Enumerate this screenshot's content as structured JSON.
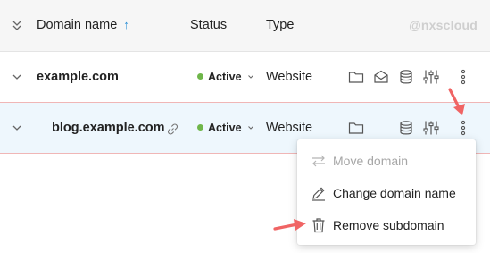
{
  "header": {
    "domain_name": "Domain name",
    "sort_arrow": "↑",
    "status": "Status",
    "type": "Type",
    "watermark": "@nxscloud"
  },
  "rows": [
    {
      "domain": "example.com",
      "status": "Active",
      "type": "Website",
      "icons": [
        "folder-icon",
        "mail-icon",
        "database-icon",
        "settings-sliders-icon",
        "more-options-icon"
      ]
    },
    {
      "domain": "blog.example.com",
      "status": "Active",
      "type": "Website",
      "icons": [
        "link-icon",
        "folder-icon",
        "database-icon",
        "settings-sliders-icon",
        "more-options-icon"
      ]
    }
  ],
  "context_menu": {
    "items": [
      {
        "label": "Move domain",
        "icon": "swap-arrows-icon",
        "enabled": false
      },
      {
        "label": "Change domain name",
        "icon": "pencil-icon",
        "enabled": true
      },
      {
        "label": "Remove subdomain",
        "icon": "trash-icon",
        "enabled": true
      }
    ]
  },
  "colors": {
    "active_dot": "#6fb64a",
    "sort_arrow": "#2a8fd6",
    "annotation_arrow": "#f06464",
    "selected_row_bg": "#eef7fd"
  }
}
